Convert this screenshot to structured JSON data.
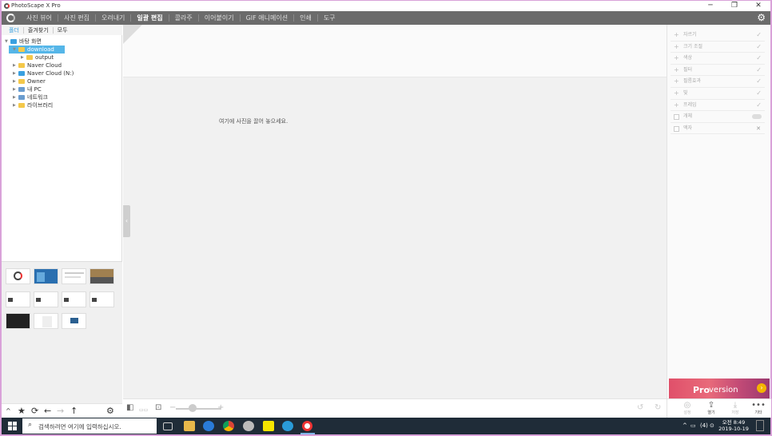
{
  "window": {
    "title": "PhotoScape X Pro",
    "controls": {
      "minimize": "─",
      "maximize": "❐",
      "close": "✕"
    }
  },
  "menu": {
    "items": [
      {
        "label": "사진 뷰어",
        "active": false
      },
      {
        "label": "사진 편집",
        "active": false
      },
      {
        "label": "오려내기",
        "active": false
      },
      {
        "label": "일괄 편집",
        "active": true
      },
      {
        "label": "콜라주",
        "active": false
      },
      {
        "label": "이어붙이기",
        "active": false
      },
      {
        "label": "GIF 애니메이션",
        "active": false
      },
      {
        "label": "인쇄",
        "active": false
      },
      {
        "label": "도구",
        "active": false
      }
    ],
    "settings_icon": "gear-icon"
  },
  "left_panel": {
    "tabs": [
      "폴더",
      "즐겨찾기",
      "모두"
    ],
    "tree": [
      {
        "label": "바탕 화면",
        "level": 0,
        "expanded": true,
        "color": "#3aa0e0"
      },
      {
        "label": "download",
        "level": 1,
        "expanded": true,
        "selected": true,
        "color": "#f4c84a"
      },
      {
        "label": "output",
        "level": 2,
        "expanded": false,
        "color": "#f4c84a"
      },
      {
        "label": "Naver Cloud",
        "level": 1,
        "expanded": false,
        "color": "#f4c84a"
      },
      {
        "label": "Naver Cloud (N:)",
        "level": 1,
        "expanded": false,
        "color": "#3aa0e0"
      },
      {
        "label": "Owner",
        "level": 1,
        "expanded": false,
        "color": "#f4c84a"
      },
      {
        "label": "내 PC",
        "level": 1,
        "expanded": false,
        "color": "#6a9ccf"
      },
      {
        "label": "네트워크",
        "level": 1,
        "expanded": false,
        "color": "#6a9ccf"
      },
      {
        "label": "라이브러리",
        "level": 1,
        "expanded": false,
        "color": "#f4c84a"
      }
    ],
    "toolbar": [
      "up-icon",
      "star-icon",
      "refresh-icon",
      "back-icon",
      "forward-icon",
      "parent-icon",
      "gear-icon"
    ]
  },
  "center": {
    "drop_hint": "여기에 사진을 끌어 놓으세요."
  },
  "right_panel": {
    "tools": [
      {
        "label": "자르기",
        "kind": "check"
      },
      {
        "label": "크기 조절",
        "kind": "check"
      },
      {
        "label": "색상",
        "kind": "check"
      },
      {
        "label": "필터",
        "kind": "check"
      },
      {
        "label": "필름효과",
        "kind": "check"
      },
      {
        "label": "빛",
        "kind": "check"
      },
      {
        "label": "프레임",
        "kind": "check"
      },
      {
        "label": "개체",
        "kind": "toggle"
      },
      {
        "label": "액자",
        "kind": "close"
      }
    ],
    "promo": {
      "pro": "Pro",
      "version": "version"
    },
    "buttons": [
      {
        "label": "설정",
        "enabled": false
      },
      {
        "label": "열기",
        "enabled": true
      },
      {
        "label": "저장",
        "enabled": false
      },
      {
        "label": "기타",
        "enabled": true
      }
    ]
  },
  "taskbar": {
    "search_placeholder": "검색하려면 여기에 입력하십시오.",
    "clock": {
      "period_time": "오전 8:49",
      "date": "2019-10-19"
    },
    "tray": {
      "chevron": "^",
      "volume": "(4)"
    }
  }
}
